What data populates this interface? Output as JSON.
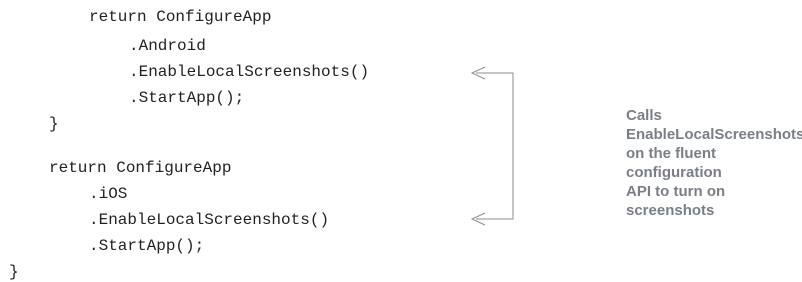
{
  "code_lines": [
    "return ConfigureApp",
    ".Android",
    ".EnableLocalScreenshots()",
    ".StartApp();",
    "}",
    "return ConfigureApp",
    ".iOS",
    ".EnableLocalScreenshots()",
    ".StartApp();",
    "}"
  ],
  "annotation": {
    "line1": "Calls EnableLocalScreenshots",
    "line2": "on the fluent configuration",
    "line3": "API to turn on screenshots"
  },
  "colors": {
    "code_text": "#222222",
    "annotation_text": "#7a7f86",
    "callout_line": "#8a8f96"
  }
}
